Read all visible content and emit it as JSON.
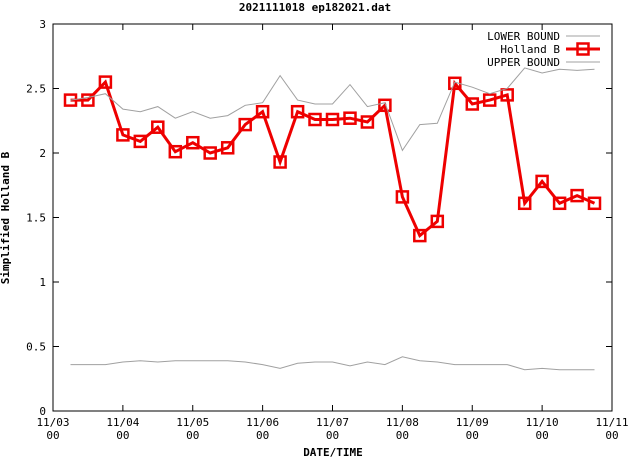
{
  "chart_data": {
    "type": "line",
    "title": "2021111018 ep182021.dat",
    "xlabel": "DATE/TIME",
    "ylabel": "Simplified Holland B",
    "ylim": [
      0,
      3
    ],
    "yticks": [
      "0",
      "0.5",
      "1",
      "1.5",
      "2",
      "2.5",
      "3"
    ],
    "xlim": [
      0,
      8
    ],
    "xticks": [
      {
        "line1": "11/03",
        "line2": "00"
      },
      {
        "line1": "11/04",
        "line2": "00"
      },
      {
        "line1": "11/05",
        "line2": "00"
      },
      {
        "line1": "11/06",
        "line2": "00"
      },
      {
        "line1": "11/07",
        "line2": "00"
      },
      {
        "line1": "11/08",
        "line2": "00"
      },
      {
        "line1": "11/09",
        "line2": "00"
      },
      {
        "line1": "11/10",
        "line2": "00"
      },
      {
        "line1": "11/11",
        "line2": "00"
      }
    ],
    "legend_position": "top-right",
    "grid": false,
    "series": [
      {
        "name": "LOWER BOUND",
        "color": "#a0a0a0",
        "marker": "none",
        "x": [
          0.25,
          0.5,
          0.75,
          1.0,
          1.25,
          1.5,
          1.75,
          2.0,
          2.25,
          2.5,
          2.75,
          3.0,
          3.25,
          3.5,
          3.75,
          4.0,
          4.25,
          4.5,
          4.75,
          5.0,
          5.25,
          5.5,
          5.75,
          6.0,
          6.25,
          6.5,
          6.75,
          7.0,
          7.25,
          7.5,
          7.75
        ],
        "values": [
          0.36,
          0.36,
          0.36,
          0.38,
          0.39,
          0.38,
          0.39,
          0.39,
          0.39,
          0.39,
          0.38,
          0.36,
          0.33,
          0.37,
          0.38,
          0.38,
          0.35,
          0.38,
          0.36,
          0.42,
          0.39,
          0.38,
          0.36,
          0.36,
          0.36,
          0.36,
          0.32,
          0.33,
          0.32,
          0.32,
          0.32
        ]
      },
      {
        "name": "Holland B",
        "color": "#ee0000",
        "marker": "square",
        "x": [
          0.25,
          0.5,
          0.75,
          1.0,
          1.25,
          1.5,
          1.75,
          2.0,
          2.25,
          2.5,
          2.75,
          3.0,
          3.25,
          3.5,
          3.75,
          4.0,
          4.25,
          4.5,
          4.75,
          5.0,
          5.25,
          5.5,
          5.75,
          6.0,
          6.25,
          6.5,
          6.75,
          7.0,
          7.25,
          7.5,
          7.75
        ],
        "values": [
          2.41,
          2.41,
          2.55,
          2.14,
          2.09,
          2.2,
          2.01,
          2.08,
          2.0,
          2.04,
          2.22,
          2.32,
          1.93,
          2.32,
          2.26,
          2.26,
          2.27,
          2.24,
          2.37,
          1.66,
          1.36,
          1.47,
          2.54,
          2.38,
          2.41,
          2.45,
          1.61,
          1.78,
          1.61,
          1.67,
          1.61
        ]
      },
      {
        "name": "UPPER BOUND",
        "color": "#a0a0a0",
        "marker": "none",
        "x": [
          0.25,
          0.5,
          0.75,
          1.0,
          1.25,
          1.5,
          1.75,
          2.0,
          2.25,
          2.5,
          2.75,
          3.0,
          3.25,
          3.5,
          3.75,
          4.0,
          4.25,
          4.5,
          4.75,
          5.0,
          5.25,
          5.5,
          5.75,
          6.0,
          6.25,
          6.5,
          6.75,
          7.0,
          7.25,
          7.5,
          7.75
        ],
        "values": [
          2.41,
          2.43,
          2.46,
          2.34,
          2.32,
          2.36,
          2.27,
          2.32,
          2.27,
          2.29,
          2.37,
          2.39,
          2.6,
          2.41,
          2.38,
          2.38,
          2.53,
          2.36,
          2.39,
          2.02,
          2.22,
          2.23,
          2.55,
          2.51,
          2.46,
          2.5,
          2.66,
          2.62,
          2.65,
          2.64,
          2.65
        ]
      }
    ]
  }
}
